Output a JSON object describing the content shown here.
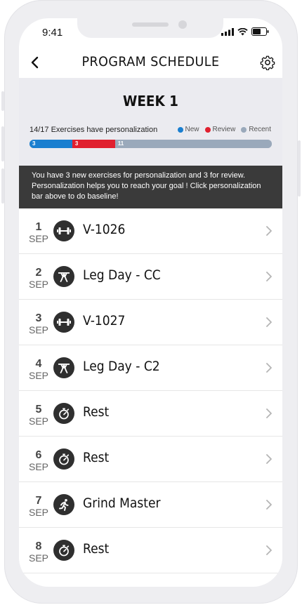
{
  "status": {
    "time": "9:41"
  },
  "header": {
    "title": "PROGRAM SCHEDULE"
  },
  "week": {
    "title": "WEEK 1",
    "personalization_text": "14/17 Exercises have personalization",
    "legend": [
      {
        "label": "New",
        "color": "#1a7fd0"
      },
      {
        "label": "Review",
        "color": "#e0202f"
      },
      {
        "label": "Recent",
        "color": "#9aa9bb"
      }
    ],
    "bar": [
      {
        "label": "3",
        "value": 3,
        "color": "#1a7fd0"
      },
      {
        "label": "3",
        "value": 3,
        "color": "#e0202f"
      },
      {
        "label": "11",
        "value": 11,
        "color": "#9aa9bb"
      }
    ]
  },
  "banner": {
    "text": "You have 3 new exercises for personalization and 3 for review. Personalization helps you to reach your goal ! Click personalization bar above to do baseline!"
  },
  "schedule": [
    {
      "day": "1",
      "month": "SEP",
      "title": "V-1026",
      "icon": "dumbbell-icon"
    },
    {
      "day": "2",
      "month": "SEP",
      "title": "Leg Day - CC",
      "icon": "squat-icon"
    },
    {
      "day": "3",
      "month": "SEP",
      "title": "V-1027",
      "icon": "dumbbell-icon"
    },
    {
      "day": "4",
      "month": "SEP",
      "title": "Leg Day - C2",
      "icon": "squat-icon"
    },
    {
      "day": "5",
      "month": "SEP",
      "title": "Rest",
      "icon": "stopwatch-icon"
    },
    {
      "day": "6",
      "month": "SEP",
      "title": "Rest",
      "icon": "stopwatch-icon"
    },
    {
      "day": "7",
      "month": "SEP",
      "title": "Grind Master",
      "icon": "runner-icon"
    },
    {
      "day": "8",
      "month": "SEP",
      "title": "Rest",
      "icon": "stopwatch-icon"
    }
  ]
}
